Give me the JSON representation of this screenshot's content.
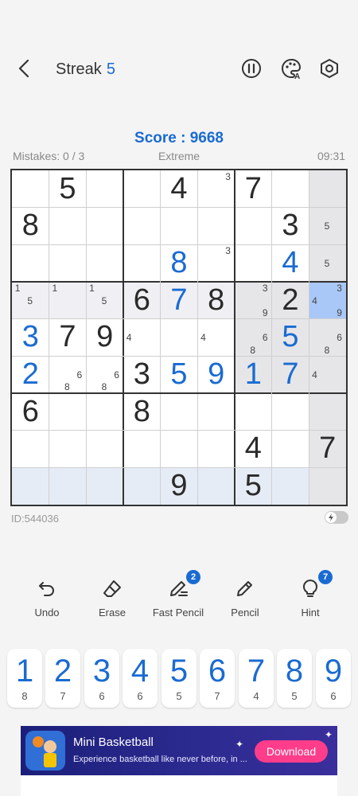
{
  "header": {
    "streak_label": "Streak",
    "streak_value": "5",
    "icons": [
      "back-arrow-icon",
      "pause-icon",
      "theme-palette-icon",
      "settings-hexagon-icon"
    ]
  },
  "score": "Score : 9668",
  "meta": {
    "mistakes": "Mistakes: 0 / 3",
    "difficulty": "Extreme",
    "time": "09:31"
  },
  "colors": {
    "accent": "#1a6bd1",
    "selected": "#a9c8f7",
    "ad_button": "#ff3d8b"
  },
  "board": {
    "cells": [
      [
        "",
        "5",
        "",
        "",
        "4",
        "",
        "7",
        "",
        ""
      ],
      [
        "8",
        "",
        "",
        "",
        "",
        "",
        "",
        "3",
        ""
      ],
      [
        "",
        "",
        "",
        "",
        "8",
        "",
        "",
        "4",
        ""
      ],
      [
        "",
        "",
        "",
        "6",
        "7",
        "8",
        "",
        "2",
        ""
      ],
      [
        "3",
        "7",
        "9",
        "",
        "",
        "",
        "",
        "5",
        ""
      ],
      [
        "2",
        "",
        "",
        "3",
        "5",
        "9",
        "1",
        "7",
        ""
      ],
      [
        "6",
        "",
        "",
        "8",
        "",
        "",
        "",
        "",
        ""
      ],
      [
        "",
        "",
        "",
        "",
        "",
        "",
        "4",
        "",
        "7"
      ],
      [
        "",
        "",
        "",
        "",
        "9",
        "",
        "5",
        "",
        ""
      ]
    ],
    "user_cells": [
      [
        2,
        4
      ],
      [
        2,
        7
      ],
      [
        3,
        4
      ],
      [
        4,
        0
      ],
      [
        4,
        7
      ],
      [
        5,
        0
      ],
      [
        5,
        4
      ],
      [
        5,
        5
      ],
      [
        5,
        6
      ],
      [
        5,
        7
      ]
    ],
    "selected": [
      3,
      8
    ],
    "notes": [
      {
        "r": 0,
        "c": 5,
        "n": "3"
      },
      {
        "r": 1,
        "c": 8,
        "n": "5"
      },
      {
        "r": 2,
        "c": 5,
        "n": "3"
      },
      {
        "r": 2,
        "c": 8,
        "n": "5"
      },
      {
        "r": 3,
        "c": 0,
        "n": "1"
      },
      {
        "r": 3,
        "c": 0,
        "n": "5"
      },
      {
        "r": 3,
        "c": 1,
        "n": "1"
      },
      {
        "r": 3,
        "c": 2,
        "n": "1"
      },
      {
        "r": 3,
        "c": 2,
        "n": "5"
      },
      {
        "r": 3,
        "c": 6,
        "n": "3"
      },
      {
        "r": 3,
        "c": 6,
        "n": "9"
      },
      {
        "r": 3,
        "c": 8,
        "n": "3"
      },
      {
        "r": 3,
        "c": 8,
        "n": "4"
      },
      {
        "r": 3,
        "c": 8,
        "n": "9"
      },
      {
        "r": 4,
        "c": 3,
        "n": "4"
      },
      {
        "r": 4,
        "c": 5,
        "n": "4"
      },
      {
        "r": 4,
        "c": 6,
        "n": "6"
      },
      {
        "r": 4,
        "c": 6,
        "n": "8"
      },
      {
        "r": 4,
        "c": 8,
        "n": "6"
      },
      {
        "r": 4,
        "c": 8,
        "n": "8"
      },
      {
        "r": 5,
        "c": 1,
        "n": "6"
      },
      {
        "r": 5,
        "c": 1,
        "n": "8"
      },
      {
        "r": 5,
        "c": 2,
        "n": "6"
      },
      {
        "r": 5,
        "c": 2,
        "n": "8"
      },
      {
        "r": 5,
        "c": 8,
        "n": "4"
      }
    ]
  },
  "puzzle_id": "ID:544036",
  "tools": [
    {
      "label": "Undo",
      "icon": "undo-icon",
      "badge": ""
    },
    {
      "label": "Erase",
      "icon": "eraser-icon",
      "badge": ""
    },
    {
      "label": "Fast Pencil",
      "icon": "fast-pencil-icon",
      "badge": "2"
    },
    {
      "label": "Pencil",
      "icon": "pencil-icon",
      "badge": ""
    },
    {
      "label": "Hint",
      "icon": "lightbulb-icon",
      "badge": "7"
    }
  ],
  "numpad": [
    {
      "digit": "1",
      "count": "8"
    },
    {
      "digit": "2",
      "count": "7"
    },
    {
      "digit": "3",
      "count": "6"
    },
    {
      "digit": "4",
      "count": "6"
    },
    {
      "digit": "5",
      "count": "5"
    },
    {
      "digit": "6",
      "count": "7"
    },
    {
      "digit": "7",
      "count": "4"
    },
    {
      "digit": "8",
      "count": "5"
    },
    {
      "digit": "9",
      "count": "6"
    }
  ],
  "ad": {
    "title": "Mini Basketball",
    "description": "Experience basketball like never before, in ...",
    "button": "Download"
  }
}
